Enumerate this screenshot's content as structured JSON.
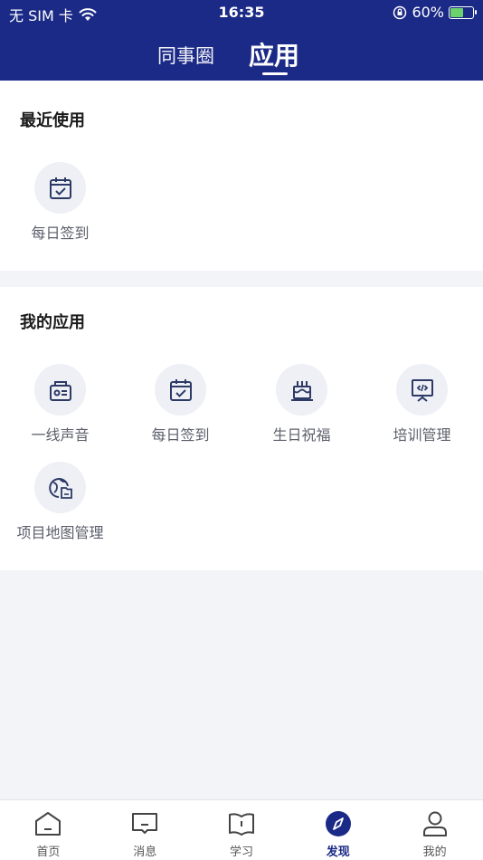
{
  "status": {
    "carrier": "无 SIM 卡",
    "time": "16:35",
    "battery": "60%",
    "battery_level": 0.6
  },
  "header": {
    "tabs": [
      {
        "label": "同事圈",
        "active": false
      },
      {
        "label": "应用",
        "active": true
      }
    ]
  },
  "recent": {
    "title": "最近使用",
    "apps": [
      {
        "label": "每日签到",
        "icon": "calendar-check-icon"
      }
    ]
  },
  "mine": {
    "title": "我的应用",
    "apps": [
      {
        "label": "一线声音",
        "icon": "radio-icon"
      },
      {
        "label": "每日签到",
        "icon": "calendar-check-icon"
      },
      {
        "label": "生日祝福",
        "icon": "birthday-cake-icon"
      },
      {
        "label": "培训管理",
        "icon": "training-board-icon"
      },
      {
        "label": "项目地图管理",
        "icon": "globe-map-icon"
      }
    ]
  },
  "tabbar": {
    "items": [
      {
        "label": "首页",
        "icon": "home-icon",
        "active": false
      },
      {
        "label": "消息",
        "icon": "message-icon",
        "active": false
      },
      {
        "label": "学习",
        "icon": "book-icon",
        "active": false
      },
      {
        "label": "发现",
        "icon": "compass-icon",
        "active": true
      },
      {
        "label": "我的",
        "icon": "user-icon",
        "active": false
      }
    ]
  },
  "colors": {
    "brand": "#1b2a86",
    "background": "#f3f4f8",
    "icon_circle": "#eef0f6",
    "battery_fill": "#6bd26b"
  }
}
